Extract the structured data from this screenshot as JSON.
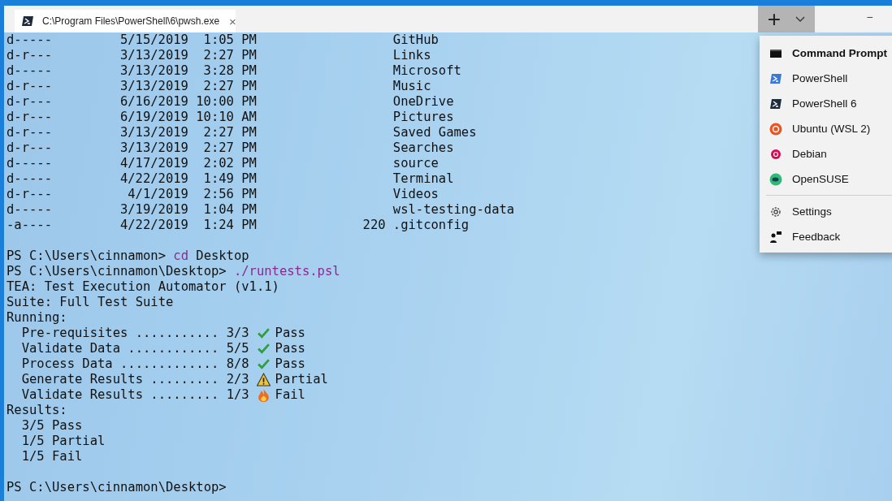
{
  "tab": {
    "title": "C:\\Program Files\\PowerShell\\6\\pwsh.exe",
    "close": "×",
    "selected": true
  },
  "new_tab": {
    "plus": "+",
    "pressed": true
  },
  "window_controls": {
    "minimize": "−"
  },
  "listing": [
    {
      "mode": "d-----",
      "date": "5/15/2019",
      "time": "1:05 PM",
      "name": "GitHub"
    },
    {
      "mode": "d-r---",
      "date": "3/13/2019",
      "time": "2:27 PM",
      "name": "Links"
    },
    {
      "mode": "d-----",
      "date": "3/13/2019",
      "time": "3:28 PM",
      "name": "Microsoft"
    },
    {
      "mode": "d-r---",
      "date": "3/13/2019",
      "time": "2:27 PM",
      "name": "Music"
    },
    {
      "mode": "d-r---",
      "date": "6/16/2019",
      "time": "10:00 PM",
      "name": "OneDrive"
    },
    {
      "mode": "d-r---",
      "date": "6/19/2019",
      "time": "10:10 AM",
      "name": "Pictures"
    },
    {
      "mode": "d-r---",
      "date": "3/13/2019",
      "time": "2:27 PM",
      "name": "Saved Games"
    },
    {
      "mode": "d-r---",
      "date": "3/13/2019",
      "time": "2:27 PM",
      "name": "Searches"
    },
    {
      "mode": "d-----",
      "date": "4/17/2019",
      "time": "2:02 PM",
      "name": "source"
    },
    {
      "mode": "d-----",
      "date": "4/22/2019",
      "time": "1:49 PM",
      "name": "Terminal"
    },
    {
      "mode": "d-r---",
      "date": "4/1/2019",
      "time": "2:56 PM",
      "name": "Videos"
    },
    {
      "mode": "d-----",
      "date": "3/19/2019",
      "time": "1:04 PM",
      "name": "wsl-testing-data"
    },
    {
      "mode": "-a----",
      "date": "4/22/2019",
      "time": "1:24 PM",
      "length": "220",
      "name": ".gitconfig"
    }
  ],
  "commands": [
    {
      "prompt": "PS C:\\Users\\cinnamon>",
      "parts": [
        {
          "kind": "command",
          "text": "cd"
        },
        {
          "kind": "argument",
          "text": "Desktop"
        }
      ]
    },
    {
      "prompt": "PS C:\\Users\\cinnamon\\Desktop>",
      "parts": [
        {
          "kind": "command",
          "text": "./runtests.psl"
        }
      ]
    }
  ],
  "output_header": [
    "TEA: Test Execution Automator (v1.1)",
    "Suite: Full Test Suite",
    "Running:"
  ],
  "tests": [
    {
      "label": "Pre-requisites ...........",
      "count": "3/3",
      "kind": "pass",
      "result": "Pass"
    },
    {
      "label": "Validate Data ............",
      "count": "5/5",
      "kind": "pass",
      "result": "Pass"
    },
    {
      "label": "Process Data .............",
      "count": "8/8",
      "kind": "pass",
      "result": "Pass"
    },
    {
      "label": "Generate Results .........",
      "count": "2/3",
      "kind": "partial",
      "result": "Partial"
    },
    {
      "label": "Validate Results .........",
      "count": "1/3",
      "kind": "fail",
      "result": "Fail"
    }
  ],
  "results_header": "Results:",
  "results": [
    "3/5 Pass",
    "1/5 Partial",
    "1/5 Fail"
  ],
  "final_prompt": "PS C:\\Users\\cinnamon\\Desktop>",
  "menu": [
    {
      "kind": "profile",
      "label": "Command Prompt",
      "default": true
    },
    {
      "kind": "profile",
      "label": "PowerShell",
      "default": false
    },
    {
      "kind": "profile",
      "label": "PowerShell 6",
      "default": false
    },
    {
      "kind": "profile",
      "label": "Ubuntu (WSL 2)",
      "default": false
    },
    {
      "kind": "profile",
      "label": "Debian",
      "default": false
    },
    {
      "kind": "profile",
      "label": "OpenSUSE",
      "default": false
    },
    {
      "kind": "separator"
    },
    {
      "kind": "action",
      "label": "Settings",
      "default": false
    },
    {
      "kind": "action",
      "label": "Feedback",
      "default": false
    }
  ]
}
